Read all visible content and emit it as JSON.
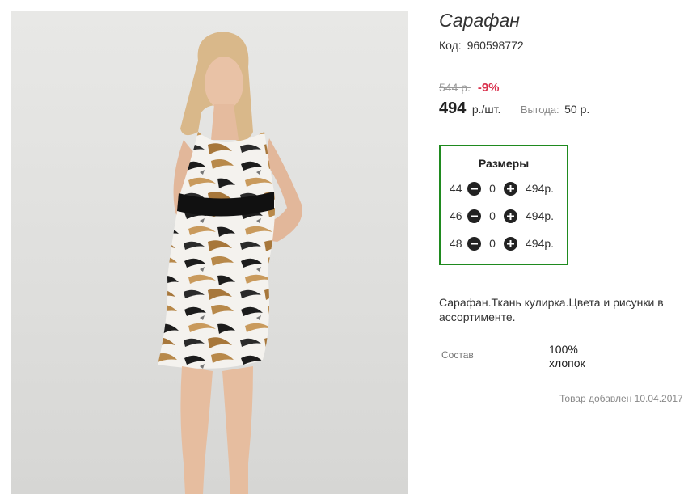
{
  "product": {
    "title": "Сарафан",
    "code_label": "Код:",
    "code": "960598772",
    "old_price": "544 р.",
    "discount": "-9%",
    "price": "494",
    "unit": "р./шт.",
    "profit_label": "Выгода:",
    "profit_value": "50 р."
  },
  "sizes": {
    "title": "Размеры",
    "rows": [
      {
        "size": "44",
        "qty": "0",
        "price": "494р."
      },
      {
        "size": "46",
        "qty": "0",
        "price": "494р."
      },
      {
        "size": "48",
        "qty": "0",
        "price": "494р."
      }
    ],
    "minus_icon": "minus-circle-icon",
    "plus_icon": "plus-circle-icon"
  },
  "description": "Сарафан.Ткань кулирка.Цвета и рисунки в ассортименте.",
  "spec": {
    "label": "Состав",
    "value": "100% хлопок"
  },
  "added": "Товар добавлен 10.04.2017",
  "colors": {
    "accent_border": "#1f8a1f",
    "discount": "#d9304c"
  }
}
